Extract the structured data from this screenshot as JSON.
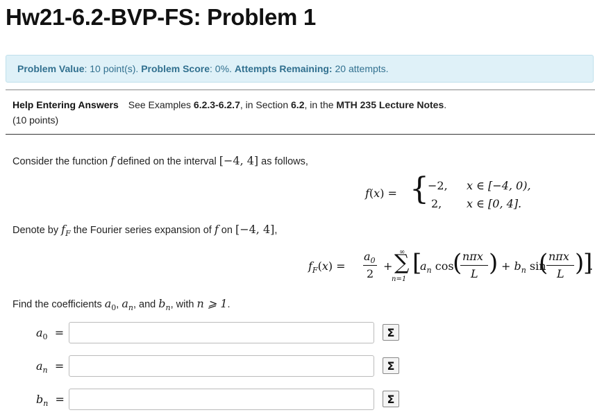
{
  "page": {
    "title": "Hw21-6.2-BVP-FS: Problem 1"
  },
  "problem_info": {
    "value_label": "Problem Value",
    "value_text": ": 10 point(s). ",
    "score_label": "Problem Score",
    "score_text": ": 0%. ",
    "attempts_label": "Attempts Remaining:",
    "attempts_text": " 20 attempts."
  },
  "help": {
    "link_label": "Help Entering Answers",
    "text_1": "See Examples ",
    "examples": "6.2.3-6.2.7",
    "text_2": ", in Section ",
    "section": "6.2",
    "text_3": ", in the ",
    "notes": "MTH 235 Lecture Notes",
    "text_4": ".",
    "points": "(10 points)"
  },
  "problem": {
    "line1_a": "Consider the function ",
    "line1_b": " defined on the interval ",
    "line1_c": " as follows,",
    "interval": "[−4, 4]",
    "piece1_val": "−2,",
    "piece1_dom": "x ∈ [−4, 0),",
    "piece2_val": "2,",
    "piece2_dom": "x ∈ [0, 4].",
    "line2_a": "Denote by ",
    "line2_b": " the Fourier series expansion of ",
    "line2_c": " on ",
    "line2_d": ",",
    "line3_a": "Find the coefficients ",
    "line3_b": ", and ",
    "line3_c": ", with ",
    "condition": "n ⩾ 1",
    "line3_d": "."
  },
  "answers": [
    {
      "label": "a0",
      "value": "",
      "sigma": "Σ"
    },
    {
      "label": "an",
      "value": "",
      "sigma": "Σ"
    },
    {
      "label": "bn",
      "value": "",
      "sigma": "Σ"
    }
  ]
}
